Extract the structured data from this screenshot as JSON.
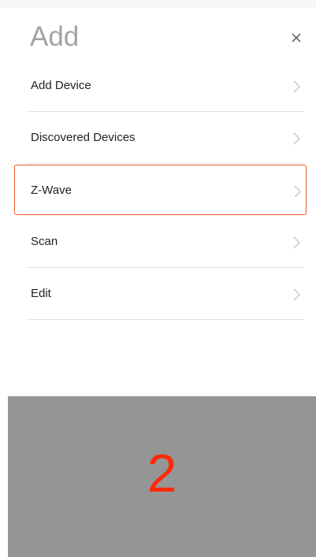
{
  "sheet": {
    "title": "Add",
    "close_icon": "close-icon",
    "chevron_icon": "chevron-right-icon",
    "items": [
      {
        "label": "Add Device",
        "highlighted": false
      },
      {
        "label": "Discovered Devices",
        "highlighted": false
      },
      {
        "label": "Z-Wave",
        "highlighted": true
      },
      {
        "label": "Scan",
        "highlighted": false
      },
      {
        "label": "Edit",
        "highlighted": false
      }
    ]
  },
  "overlay": {
    "step_number": "2"
  },
  "colors": {
    "highlight_border": "#f05a2b",
    "step_number": "#ff2a0a",
    "overlay_background": "#959595",
    "title": "#a3a3a3"
  }
}
